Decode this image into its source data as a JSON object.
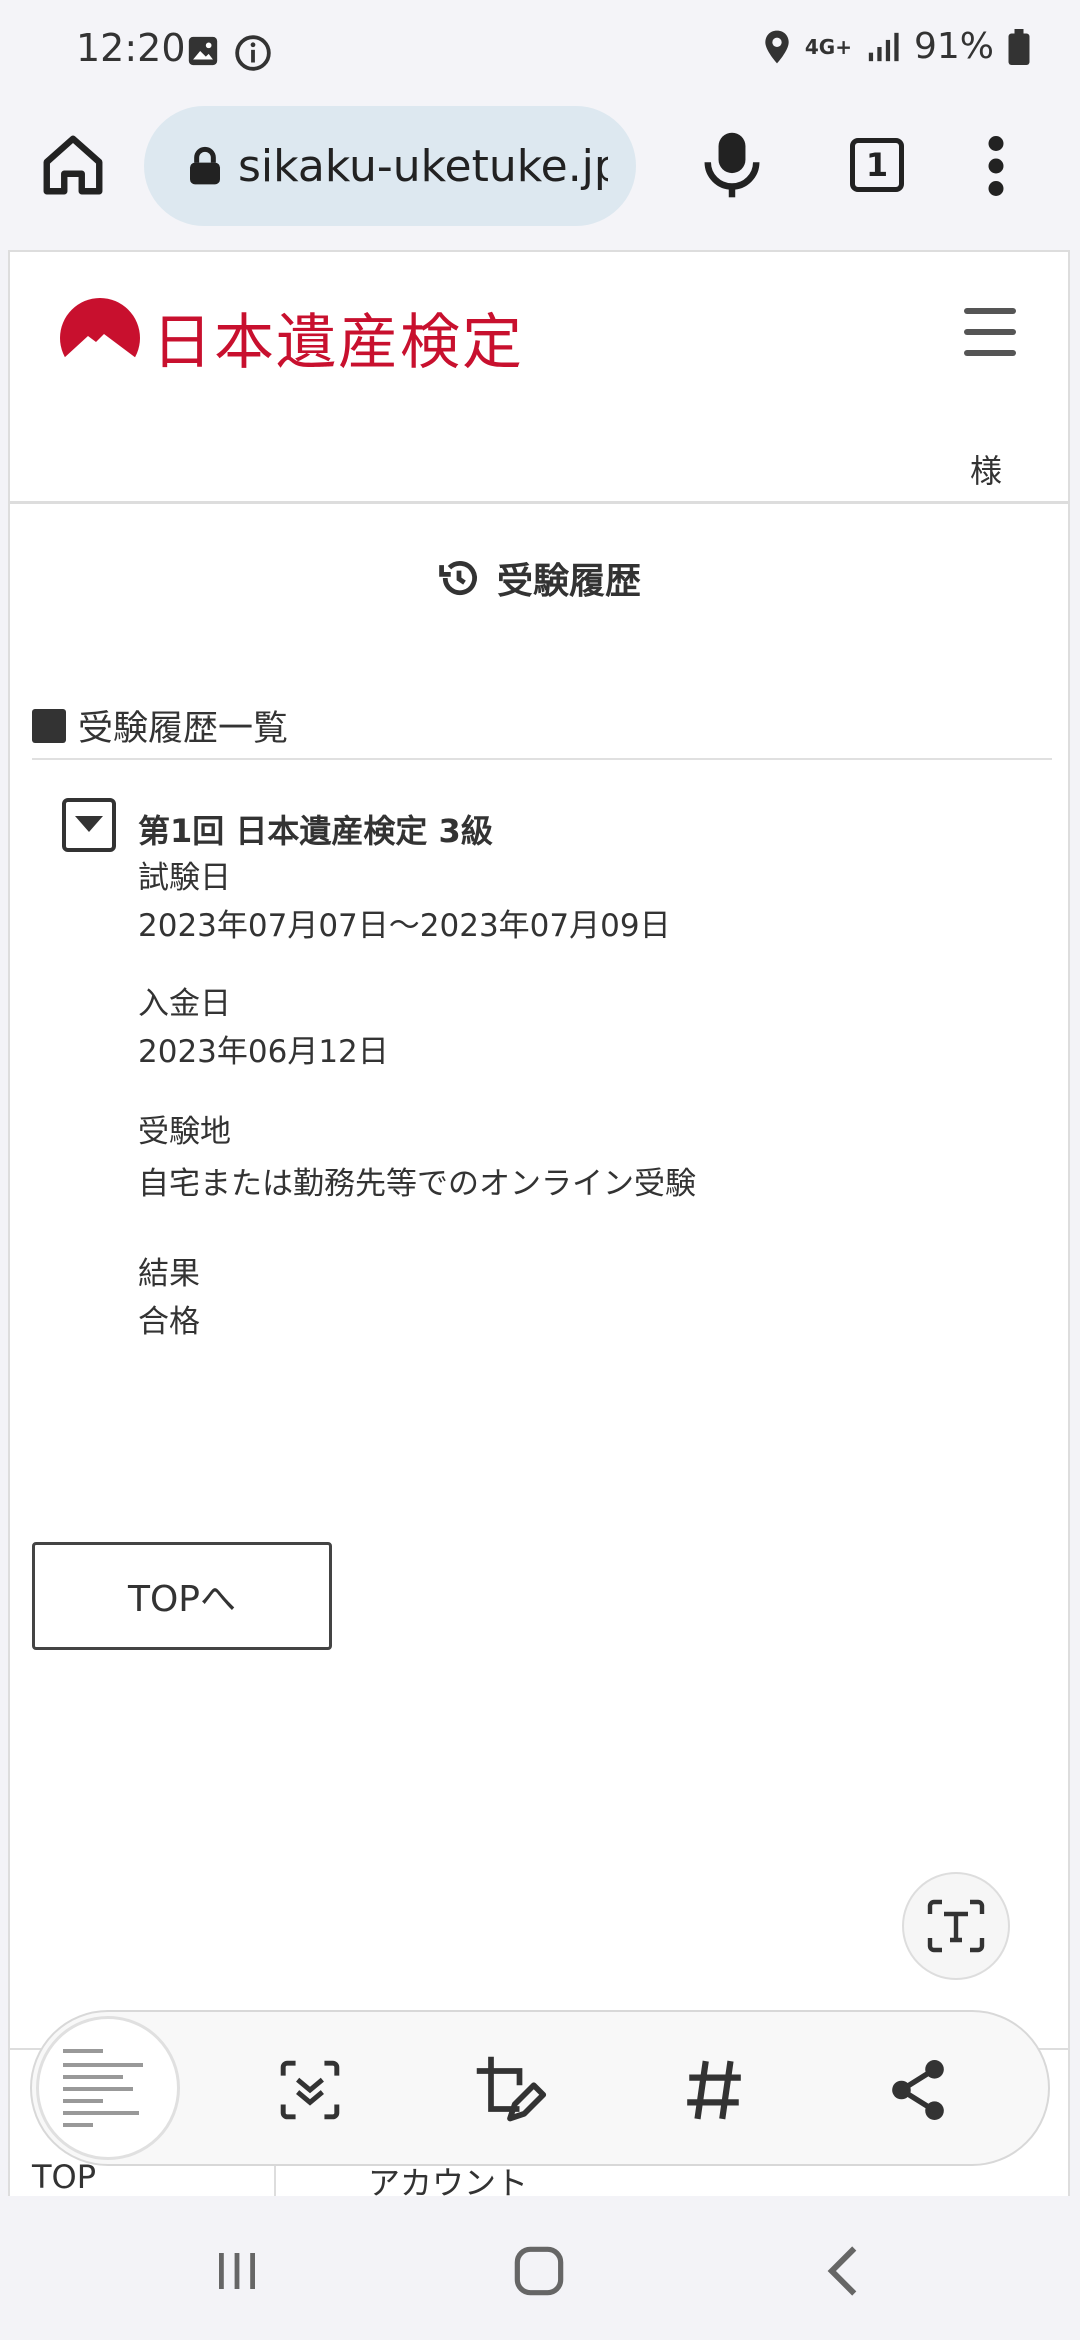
{
  "status_bar": {
    "time": "12:20",
    "network": "4G+",
    "battery": "91%",
    "icons": [
      "image-icon",
      "info-icon",
      "location-icon",
      "signal-icon",
      "battery-icon"
    ]
  },
  "browser": {
    "url": "sikaku-uketuke.jp",
    "tab_count": "1"
  },
  "header": {
    "logo_text": "日本遺産検定",
    "user_suffix": "様",
    "brand_color": "#c8102e"
  },
  "page": {
    "title": "受験履歴",
    "list_heading": "受験履歴一覧",
    "entry": {
      "title": "第1回 日本遺産検定 3級",
      "exam_date_label": "試験日",
      "exam_date": "2023年07月07日〜2023年07月09日",
      "payment_date_label": "入金日",
      "payment_date": "2023年06月12日",
      "location_label": "受験地",
      "location": "自宅または勤務先等でのオンライン受験",
      "result_label": "結果",
      "result": "合格"
    },
    "top_button": "TOPへ"
  },
  "bottom_nav": {
    "top": "TOP",
    "account": "アカウント"
  },
  "capture_toolbar": {
    "buttons": [
      "scroll-capture-icon",
      "crop-edit-icon",
      "hashtag-icon",
      "share-icon"
    ]
  }
}
